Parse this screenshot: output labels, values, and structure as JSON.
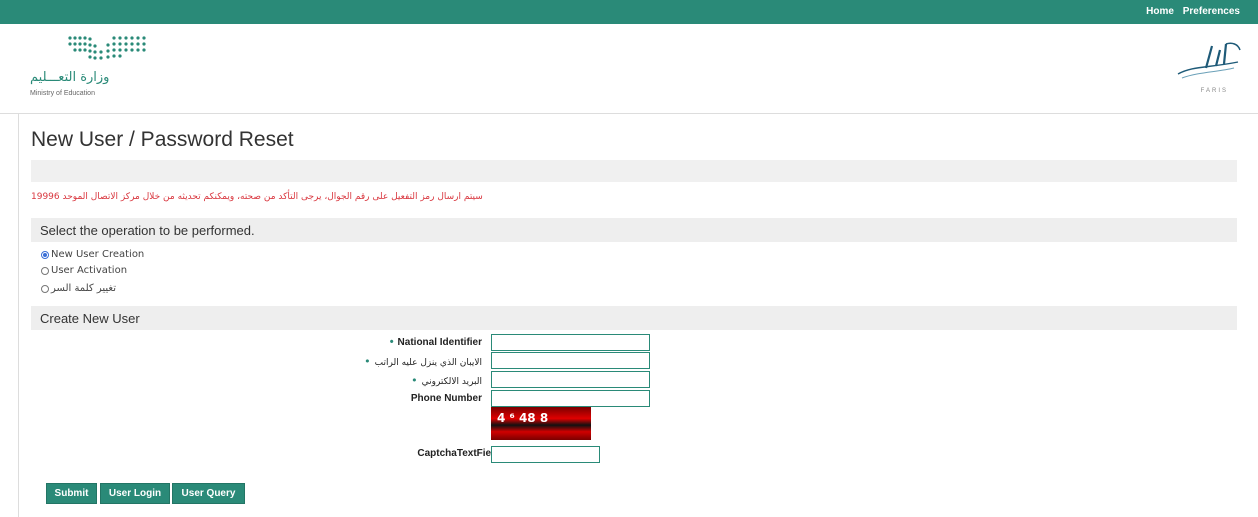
{
  "topbar": {
    "links": [
      "Home",
      "Preferences"
    ]
  },
  "header": {
    "moe_name_ar": "وزارة التعـــليم",
    "moe_name_en": "Ministry of Education",
    "faris_text": "FARIS"
  },
  "page": {
    "title": "New User / Password Reset",
    "notice": "سيتم ارسال رمز التفعيل على رقم الجوال، يرجى التأكد من صحته، ويمكنكم تحديثه من خلال مركز الاتصال الموحد 19996"
  },
  "operation": {
    "heading": "Select the operation to be performed.",
    "options": [
      {
        "label": "New User Creation",
        "checked": true
      },
      {
        "label": "User Activation",
        "checked": false
      },
      {
        "label": "تغيير كلمة السر",
        "checked": false
      }
    ]
  },
  "create_user": {
    "heading": "Create New User",
    "fields": [
      {
        "label": "National Identifier",
        "required": true,
        "value": ""
      },
      {
        "label": "الايبان الذي ينزل عليه الراتب",
        "required": true,
        "value": ""
      },
      {
        "label": "البريد الالكتروني",
        "required": true,
        "value": ""
      },
      {
        "label": "Phone Number",
        "required": false,
        "value": ""
      }
    ],
    "captcha_text": "4 ⁶ 48 8",
    "captcha_label": "CaptchaTextField",
    "captcha_value": ""
  },
  "buttons": {
    "submit": "Submit",
    "user_login": "User Login",
    "user_query": "User Query"
  },
  "colors": {
    "accent": "#2a8a78",
    "notice": "#d9363e"
  }
}
